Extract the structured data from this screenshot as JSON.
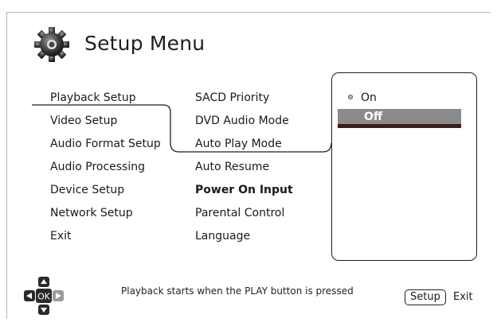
{
  "title": "Setup Menu",
  "title_icon": "gear-icon",
  "left_menu": [
    {
      "label": "Playback Setup",
      "selected": true
    },
    {
      "label": "Video Setup"
    },
    {
      "label": "Audio Format Setup"
    },
    {
      "label": "Audio Processing"
    },
    {
      "label": "Device Setup"
    },
    {
      "label": "Network Setup"
    },
    {
      "label": "Exit"
    }
  ],
  "middle_menu": [
    {
      "label": "SACD Priority"
    },
    {
      "label": "DVD Audio Mode"
    },
    {
      "label": "Auto Play Mode",
      "selected": true
    },
    {
      "label": "Auto Resume"
    },
    {
      "label": "Power On Input",
      "bold": true
    },
    {
      "label": "Parental Control"
    },
    {
      "label": "Language"
    }
  ],
  "options": {
    "on_label": "On",
    "off_label": "Off",
    "current": "On",
    "highlighted": "Off"
  },
  "footer": {
    "hint": "Playback starts when the PLAY button is pressed",
    "ok_label": "OK",
    "setup_key": "Setup",
    "exit_label": "Exit"
  },
  "colors": {
    "highlight_bar": "#8b8b8b",
    "highlight_underline": "#3d1d1d",
    "text": "#1a1a1a"
  }
}
